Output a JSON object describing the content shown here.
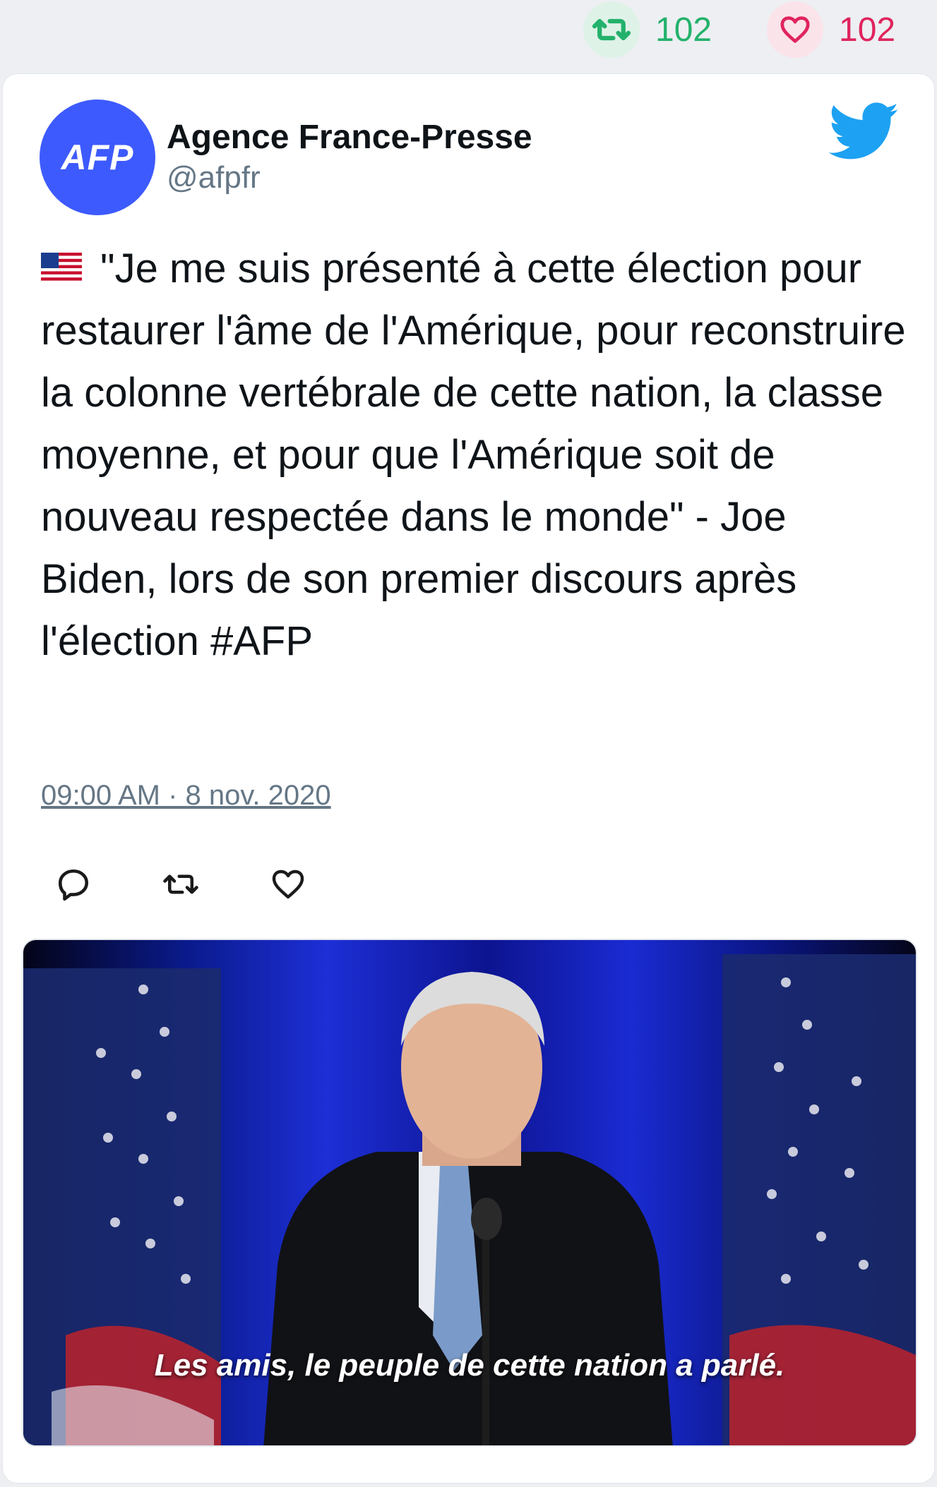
{
  "top_stats": {
    "retweet_count": "102",
    "like_count": "102"
  },
  "tweet": {
    "author_name": "Agence France-Presse",
    "author_handle": "@afpfr",
    "avatar_text": "AFP",
    "flag_icon": "us-flag-emoji",
    "body": "\"Je me suis présenté à cette élection pour restaurer l'âme de l'Amérique, pour reconstruire la colonne vertébrale de cette nation, la classe moyenne, et pour que l'Amérique soit de nouveau respectée dans le monde\" - Joe Biden, lors de son premier discours après l'élection #AFP",
    "timestamp": "09:00 AM · 8 nov. 2020",
    "media_caption": "Les amis, le peuple de cette nation a parlé."
  },
  "colors": {
    "retweet": "#23b26b",
    "like": "#e0245e",
    "twitter_blue": "#1da1f2",
    "avatar_bg": "#3d5afe",
    "muted": "#657786"
  },
  "icons": [
    "retweet-icon",
    "heart-icon",
    "twitter-bird-icon",
    "reply-icon",
    "retweet-action-icon",
    "like-action-icon"
  ]
}
